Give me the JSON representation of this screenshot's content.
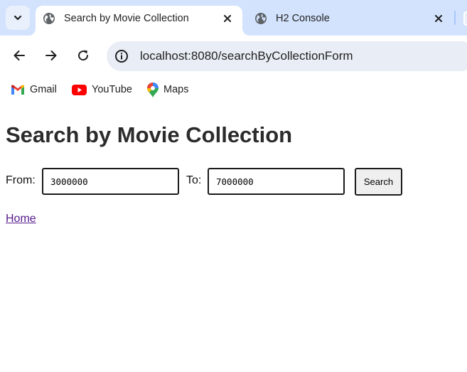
{
  "browser": {
    "tabs": [
      {
        "title": "Search by Movie Collection",
        "active": true
      },
      {
        "title": "H2 Console",
        "active": false
      }
    ],
    "address": "localhost:8080/searchByCollectionForm",
    "bookmarks": [
      {
        "label": "Gmail",
        "icon": "gmail-icon"
      },
      {
        "label": "YouTube",
        "icon": "youtube-icon"
      },
      {
        "label": "Maps",
        "icon": "maps-icon"
      }
    ],
    "colors": {
      "tabstrip": "#d3e3fd",
      "omnibox": "#e9eef6"
    }
  },
  "page": {
    "heading": "Search by Movie Collection",
    "from_label": "From:",
    "from_value": "3000000",
    "to_label": "To:",
    "to_value": "7000000",
    "search_button": "Search",
    "home_link": "Home"
  }
}
